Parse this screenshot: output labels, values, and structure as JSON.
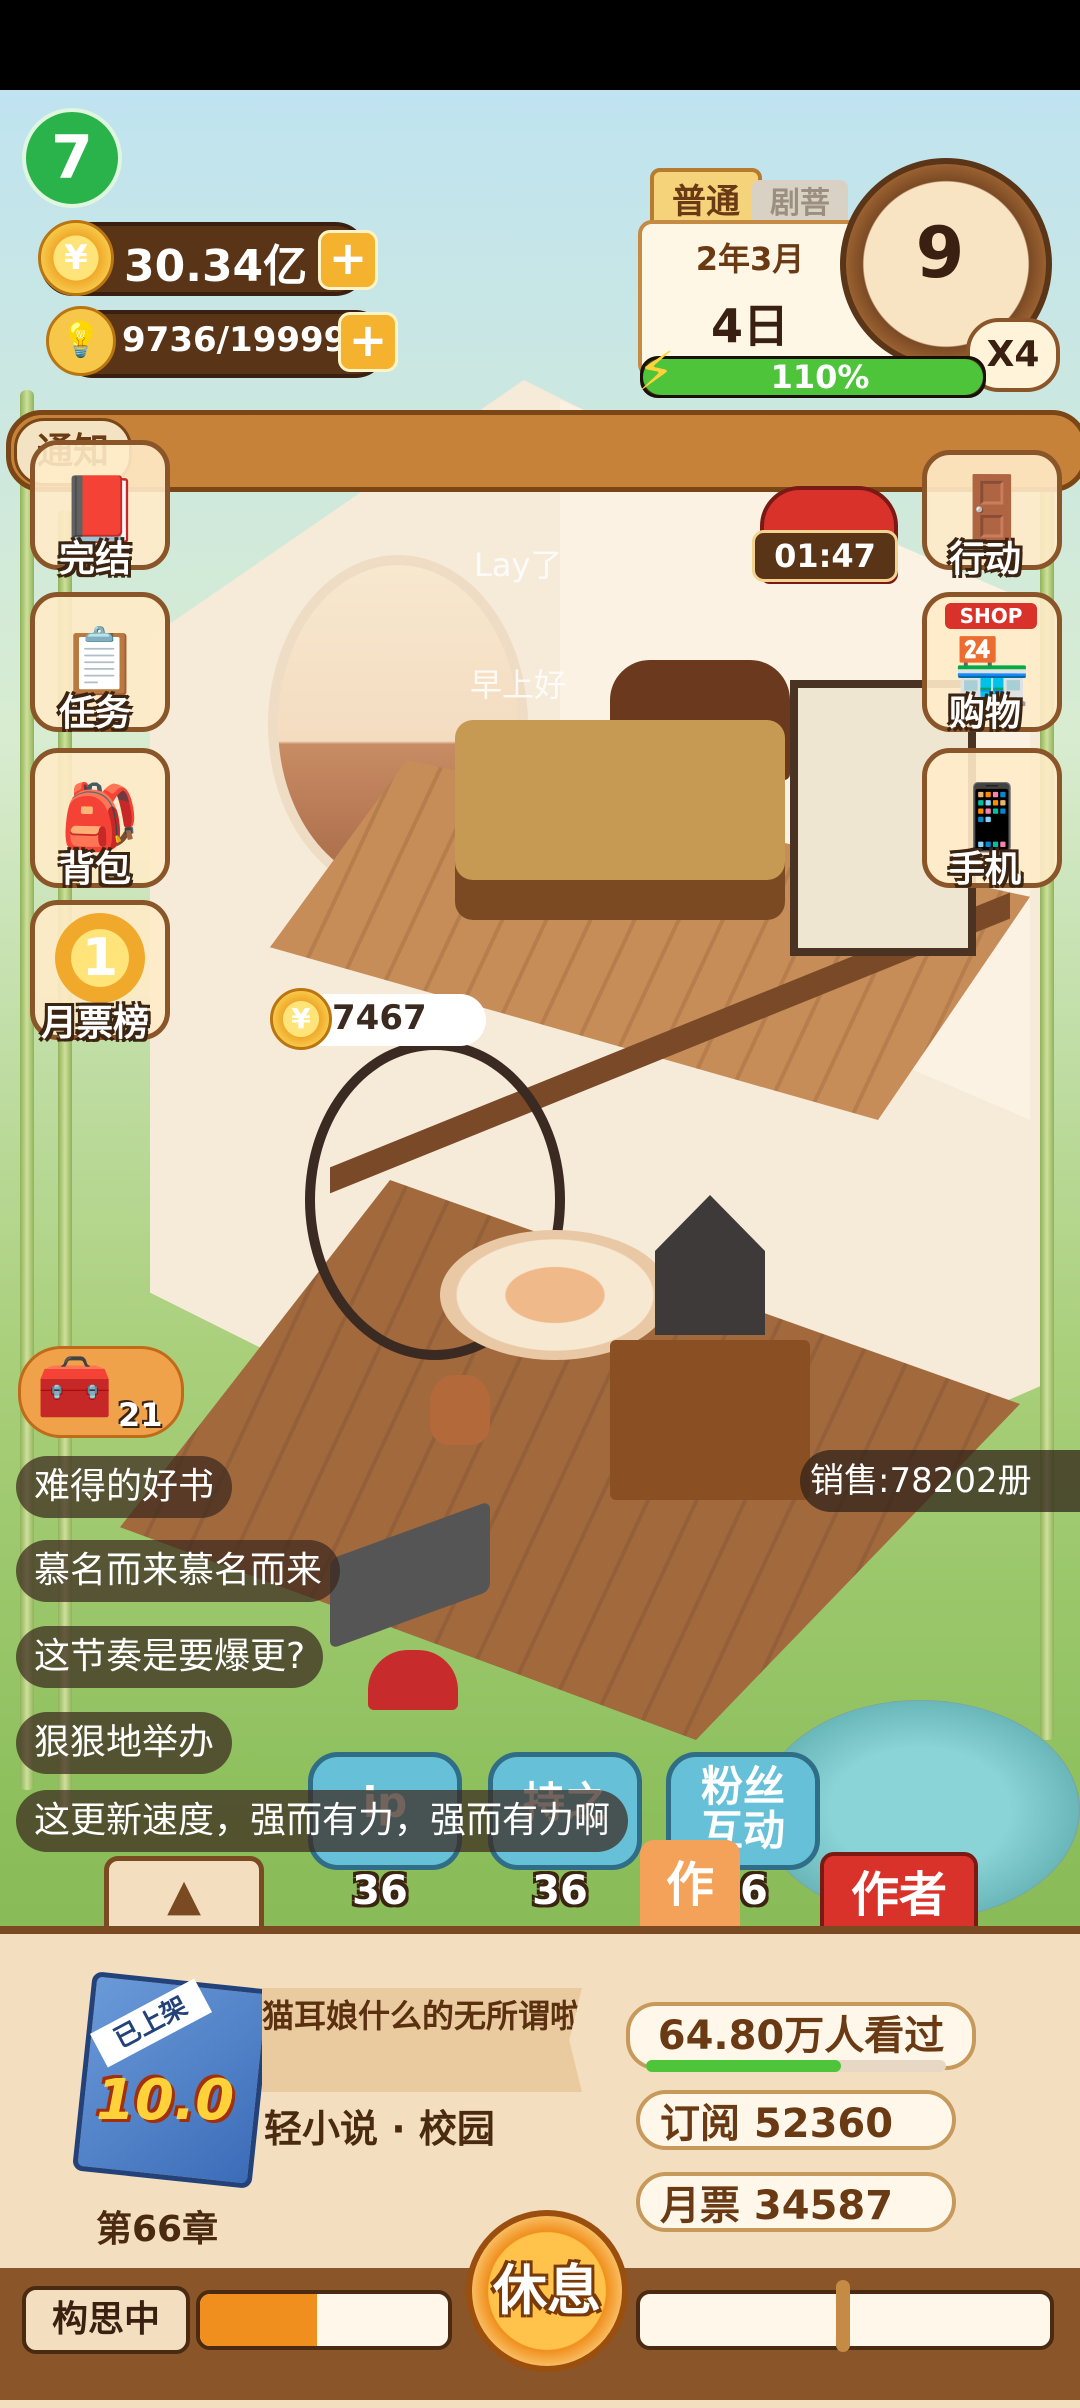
{
  "top": {
    "logo_char": "7",
    "coins": "30.34亿",
    "energy": "9736/19999",
    "difficulty_tab": "普通",
    "difficulty_tab2": "剧菩",
    "date_year_month": "2年3月",
    "date_day": "4日",
    "clock_number": "9",
    "speed": "X4",
    "stamina_percent_text": "110%",
    "stamina_fraction": 1.0
  },
  "notice": {
    "label": "通知"
  },
  "left_menu": [
    {
      "label": "完结",
      "icon": "book-icon"
    },
    {
      "label": "任务",
      "icon": "clipboard-icon"
    },
    {
      "label": "背包",
      "icon": "bag-icon"
    },
    {
      "label": "月票榜",
      "icon": "coin-icon",
      "badge": "1"
    }
  ],
  "right_menu": [
    {
      "label": "行动",
      "icon": "door-icon"
    },
    {
      "label": "购物",
      "icon": "shop-icon",
      "sign": "SHOP"
    },
    {
      "label": "手机",
      "icon": "phone-icon"
    }
  ],
  "timer": "01:47",
  "floating_text": [
    "Lay了",
    "早上好"
  ],
  "coin_bubble": "7467",
  "chest_count": "21",
  "sales": "销售:78202册",
  "comments": [
    "难得的好书",
    "慕名而来慕名而来",
    "这节奏是要爆更?",
    "狠狠地举办",
    "这更新速度，强而有力，强而有力啊"
  ],
  "actions": [
    {
      "label": "ip",
      "count": "36"
    },
    {
      "label": "持之",
      "count": "36"
    },
    {
      "label": "粉丝互动",
      "count": "36"
    }
  ],
  "partial_labels": {
    "work": "作",
    "author": "作者"
  },
  "book": {
    "status_badge": "已上架",
    "score": "10.0",
    "title": "猫耳娘什么的无所谓啦",
    "genre": "轻小说 · 校园",
    "chapter": "第66章"
  },
  "stats": {
    "views": "64.80万人看过",
    "views_fraction": 0.65,
    "subscribe": "订阅 52360",
    "monthly_ticket": "月票 34587"
  },
  "bottom": {
    "status_label": "构思中",
    "progress_fraction": 0.47,
    "rest_button": "休息"
  },
  "colors": {
    "accent_orange": "#f08f1d",
    "panel_brown": "#7a4a22",
    "stamina_green": "#4ec43a",
    "action_blue": "#66c1d8",
    "author_red": "#d8322b"
  }
}
